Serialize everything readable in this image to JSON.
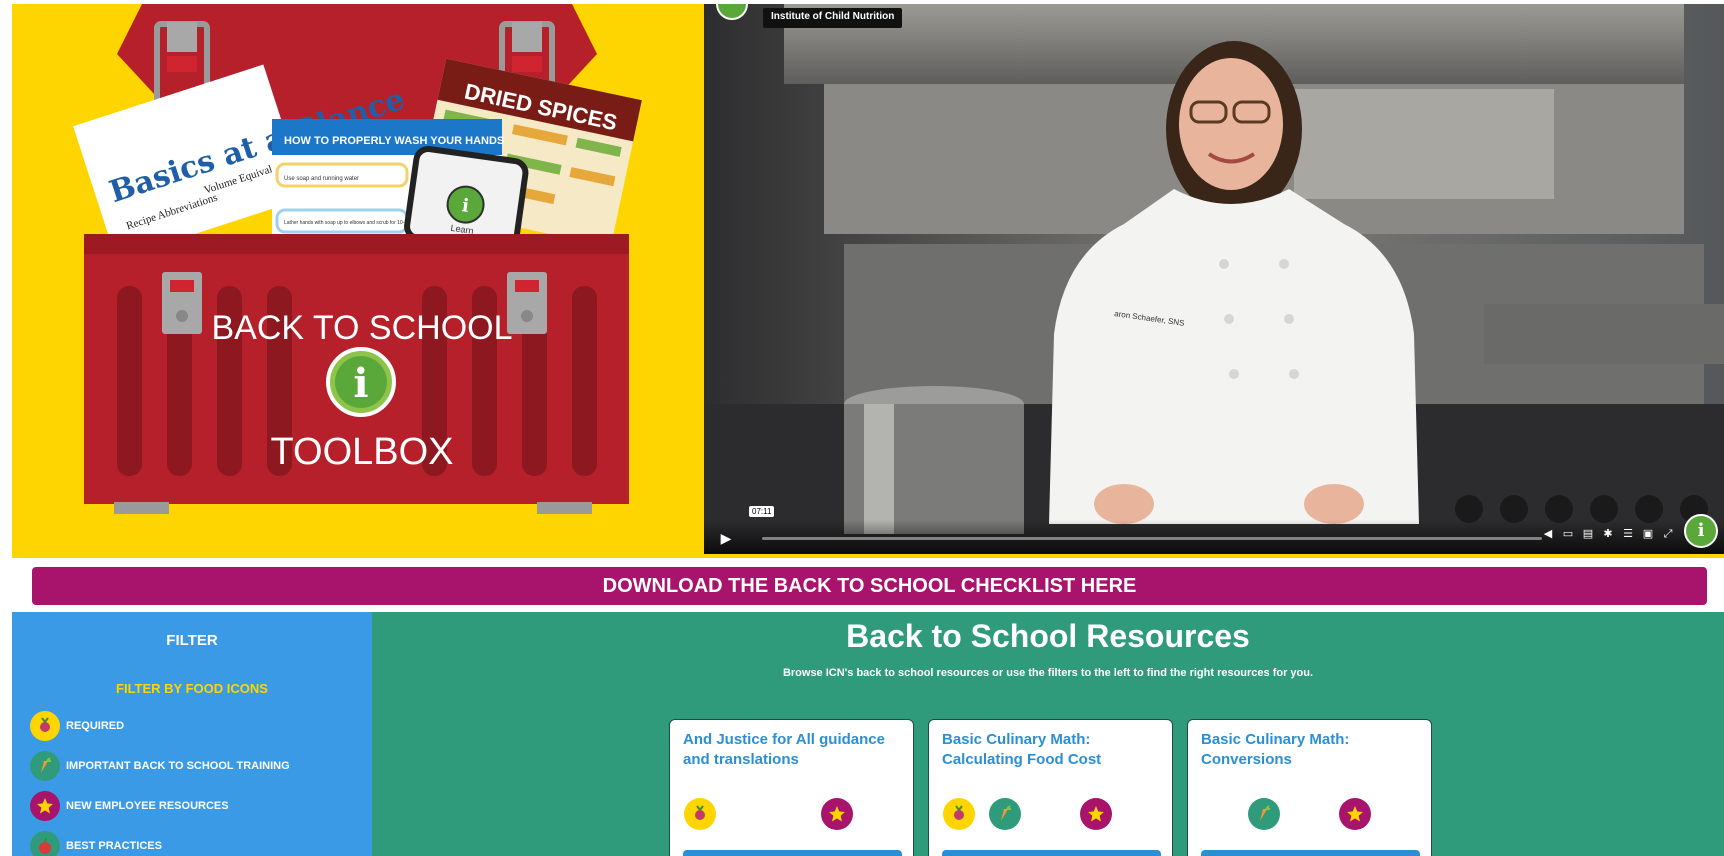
{
  "hero": {
    "toolbox": {
      "lid_label": "",
      "sign_top": "BACK TO SCHOOL",
      "sign_bottom": "TOOLBOX",
      "sign_logo": "i",
      "doc1_title": "Basics at a Glance",
      "doc1_col1": "Recipe Abbreviations",
      "doc1_col2": "Volume Equivalents for Liquids",
      "doc2_title": "HOW TO PROPERLY WASH YOUR HANDS",
      "doc2_line1": "Use soap and running water",
      "doc2_line2": "Lather hands with soap up to elbows and scrub for 10-15 seconds.",
      "doc3_title": "DRIED SPICES",
      "phone_label": "Learn",
      "phone_logo": "i"
    },
    "video": {
      "channel_title": "Institute of Child Nutrition",
      "timestamp": "07:11",
      "progress": 0.0,
      "jacket_name": "aron Schaefer, SNS",
      "corner_logo": "i"
    }
  },
  "download": {
    "label": "DOWNLOAD THE BACK TO SCHOOL CHECKLIST HERE"
  },
  "filter": {
    "title": "FILTER",
    "subtitle": "FILTER BY FOOD ICONS",
    "items": [
      {
        "label": "REQUIRED",
        "icon": "beet-icon",
        "color": "#ffd500"
      },
      {
        "label": "IMPORTANT BACK TO SCHOOL TRAINING",
        "icon": "carrot-icon",
        "color": "#2f9b7a"
      },
      {
        "label": "NEW EMPLOYEE RESOURCES",
        "icon": "star-icon",
        "color": "#a8146b"
      },
      {
        "label": "BEST PRACTICES",
        "icon": "apple-icon",
        "color": "#2f9b7a"
      }
    ]
  },
  "resources": {
    "title": "Back to School Resources",
    "subtitle": "Browse ICN's back to school resources or use the filters to the left to find the right resources for you.",
    "cards": [
      {
        "title": "And Justice for All guidance and translations"
      },
      {
        "title": "Basic Culinary Math: Calculating Food Cost"
      },
      {
        "title": "Basic Culinary Math: Conversions"
      }
    ]
  },
  "colors": {
    "yellow": "#ffd500",
    "magenta": "#a8146b",
    "blue": "#3a9ae6",
    "teal": "#2f9b7a",
    "toolbox_red": "#b5202a"
  }
}
